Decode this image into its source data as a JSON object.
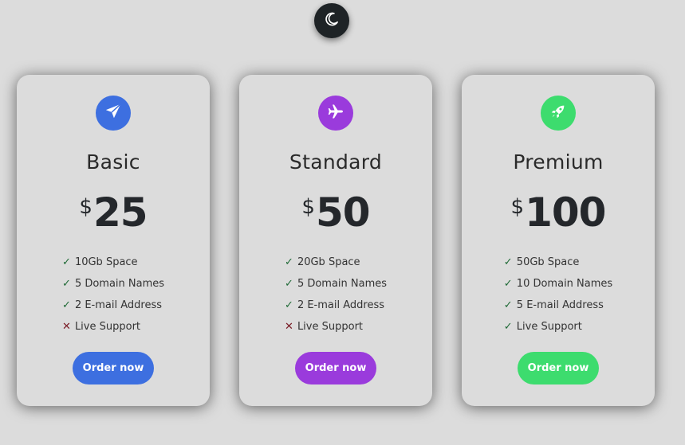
{
  "theme_toggle": {
    "icon": "moon-icon"
  },
  "plans": [
    {
      "name": "Basic",
      "currency": "$",
      "price": "25",
      "icon": "paper-plane-icon",
      "accent": "#3d6fe0",
      "features": [
        {
          "text": "10Gb Space",
          "included": true
        },
        {
          "text": "5 Domain Names",
          "included": true
        },
        {
          "text": "2 E-mail Address",
          "included": true
        },
        {
          "text": "Live Support",
          "included": false
        }
      ],
      "button_label": "Order now"
    },
    {
      "name": "Standard",
      "currency": "$",
      "price": "50",
      "icon": "airplane-icon",
      "accent": "#9a3bdc",
      "features": [
        {
          "text": "20Gb Space",
          "included": true
        },
        {
          "text": "5 Domain Names",
          "included": true
        },
        {
          "text": "2 E-mail Address",
          "included": true
        },
        {
          "text": "Live Support",
          "included": false
        }
      ],
      "button_label": "Order now"
    },
    {
      "name": "Premium",
      "currency": "$",
      "price": "100",
      "icon": "rocket-icon",
      "accent": "#3ddc6e",
      "features": [
        {
          "text": "50Gb Space",
          "included": true
        },
        {
          "text": "10 Domain Names",
          "included": true
        },
        {
          "text": "5 E-mail Address",
          "included": true
        },
        {
          "text": "Live Support",
          "included": true
        }
      ],
      "button_label": "Order now"
    }
  ],
  "marks": {
    "included": "✓",
    "excluded": "✕"
  }
}
